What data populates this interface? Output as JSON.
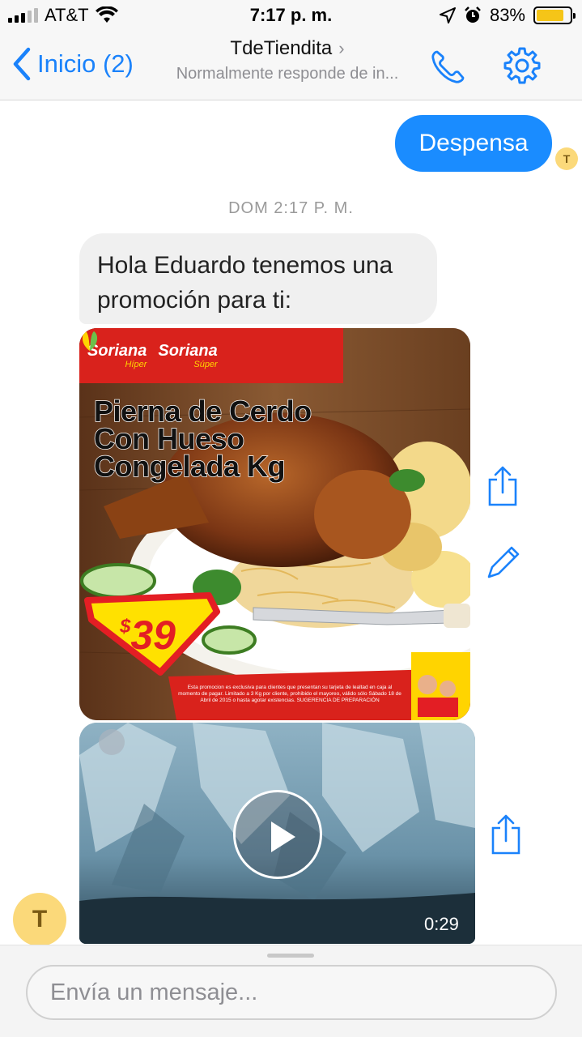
{
  "status_bar": {
    "carrier": "AT&T",
    "time": "7:17 p. m.",
    "battery": "83%",
    "battery_level": 0.83
  },
  "header": {
    "back_label": "Inicio (2)",
    "title": "TdeTiendita",
    "subtitle": "Normalmente responde de in..."
  },
  "messages": {
    "outgoing_text": "Despensa",
    "read_avatar_initial": "T",
    "timestamp": "DOM 2:17 P. M.",
    "incoming_text": "Hola Eduardo tenemos una promoción para ti:",
    "sender_initial": "T"
  },
  "promo_image": {
    "brand_1": "Soriana",
    "brand_1_sub": "Híper",
    "brand_2": "Soriana",
    "brand_2_sub": "Súper",
    "product_line_1": "Pierna de Cerdo",
    "product_line_2": "Con Hueso",
    "product_line_3": "Congelada Kg",
    "price_symbol": "$",
    "price": "39",
    "disclaimer": "Esta promocion es exclusiva para clientes que presentan su tarjeta de lealtad en caja al momento de pagar. Limitado a 3 Kg por cliente, prohibido el mayoreo, válido sólo Sábado 18 de Abril de 2015 o hasta agotar existencias. SUGERENCIA DE PREPARACIÓN",
    "colors": {
      "banner_red": "#d9221c",
      "price_yellow": "#ffe100",
      "price_red": "#e31e24"
    }
  },
  "video": {
    "duration": "0:29"
  },
  "composer": {
    "placeholder": "Envía un mensaje..."
  },
  "colors": {
    "accent": "#1a8cff",
    "avatar": "#fbd97a"
  },
  "icons": [
    "chevron-left-icon",
    "phone-icon",
    "gear-icon",
    "share-icon",
    "pencil-icon",
    "play-icon"
  ]
}
